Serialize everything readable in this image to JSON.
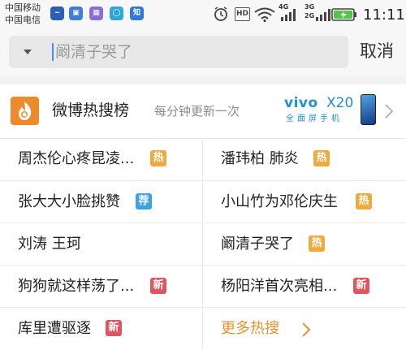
{
  "status_bar": {
    "carrier_1": "中国移动",
    "carrier_2": "中国电信",
    "hd": "HD",
    "net_4g": "4G",
    "net_3g": "3G",
    "net_2g": "2G",
    "time": "11:11"
  },
  "search": {
    "query": "阚清子哭了",
    "cancel_label": "取消"
  },
  "hot_card": {
    "title": "微博热搜榜",
    "subtitle": "每分钟更新一次",
    "ad_brand": "vivo",
    "ad_model": "X20",
    "ad_tagline": "全面屏手机",
    "items": [
      {
        "text": "周杰伦心疼昆凌...",
        "badge": "热",
        "badge_color": "#f0a93c"
      },
      {
        "text": "潘玮柏 肺炎",
        "badge": "热",
        "badge_color": "#f0a93c"
      },
      {
        "text": "张大大小脸挑赞",
        "badge": "荐",
        "badge_color": "#3aa3e3"
      },
      {
        "text": "小山竹为邓伦庆生",
        "badge": "热",
        "badge_color": "#f0a93c"
      },
      {
        "text": "刘涛 王珂",
        "badge": "",
        "badge_color": ""
      },
      {
        "text": "阚清子哭了",
        "badge": "热",
        "badge_color": "#f0a93c"
      },
      {
        "text": "狗狗就这样荡了...",
        "badge": "新",
        "badge_color": "#e0565e"
      },
      {
        "text": "杨阳洋首次亮相...",
        "badge": "新",
        "badge_color": "#e0565e"
      },
      {
        "text": "库里遭驱逐",
        "badge": "新",
        "badge_color": "#e0565e"
      }
    ],
    "more_label": "更多热搜"
  },
  "icons": {
    "search_dropdown": "chevron-down-icon",
    "header_logo": "flame-search-icon",
    "header_arrow": "chevron-right-icon",
    "more_arrow": "chevron-right-icon"
  },
  "colors": {
    "hot": "#f0a93c",
    "recommend": "#3aa3e3",
    "new": "#e0565e",
    "more": "#e8922d"
  }
}
